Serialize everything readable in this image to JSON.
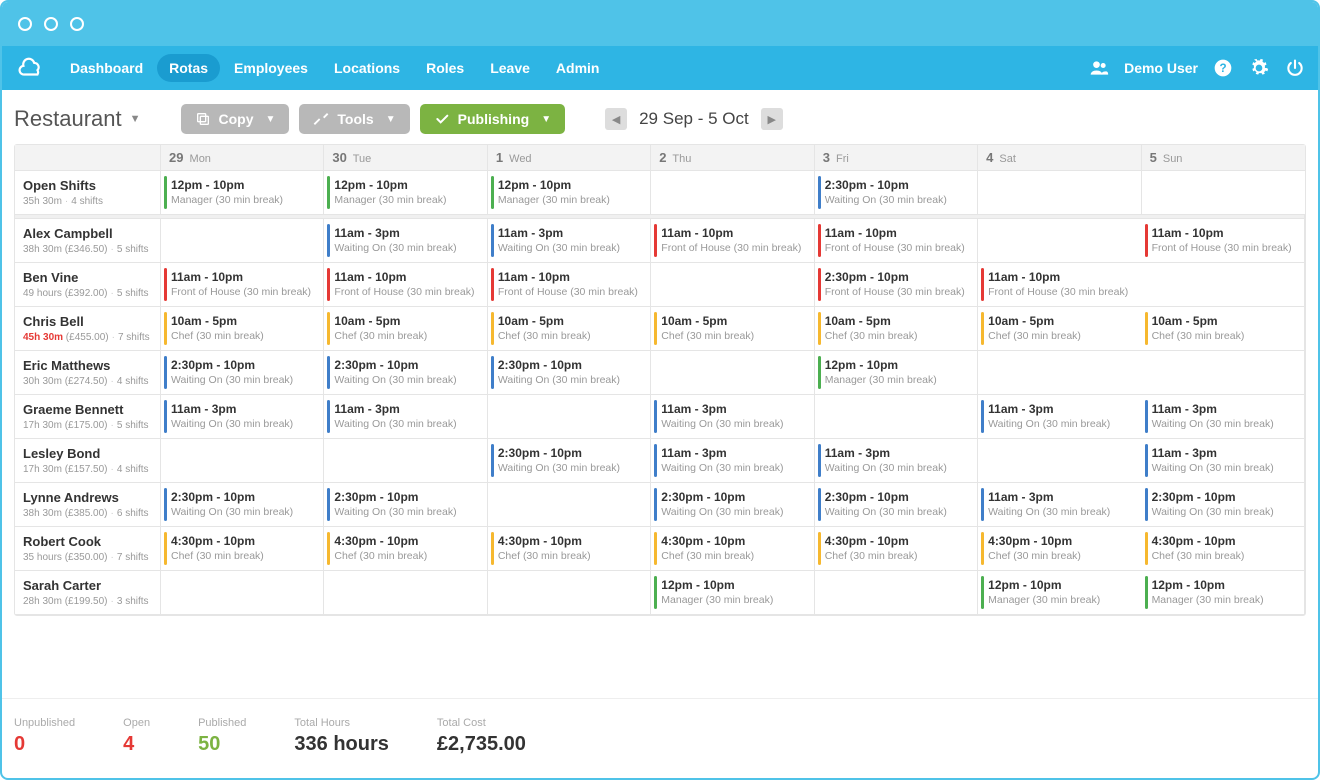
{
  "nav": {
    "items": [
      "Dashboard",
      "Rotas",
      "Employees",
      "Locations",
      "Roles",
      "Leave",
      "Admin"
    ],
    "active": 1,
    "user": "Demo User"
  },
  "page": {
    "title": "Restaurant"
  },
  "buttons": {
    "copy": "Copy",
    "tools": "Tools",
    "publishing": "Publishing"
  },
  "dateRange": "29 Sep - 5 Oct",
  "days": [
    {
      "num": "29",
      "name": "Mon"
    },
    {
      "num": "30",
      "name": "Tue"
    },
    {
      "num": "1",
      "name": "Wed"
    },
    {
      "num": "2",
      "name": "Thu"
    },
    {
      "num": "3",
      "name": "Fri"
    },
    {
      "num": "4",
      "name": "Sat"
    },
    {
      "num": "5",
      "name": "Sun"
    }
  ],
  "roleColors": {
    "Manager": "green",
    "Waiting On": "blue",
    "Front of House": "red",
    "Chef": "yellow"
  },
  "rows": [
    {
      "name": "Open Shifts",
      "meta": "35h 30m",
      "shifts_label": "4 shifts",
      "cells": [
        {
          "time": "12pm - 10pm",
          "role": "Manager (30 min break)"
        },
        {
          "time": "12pm - 10pm",
          "role": "Manager (30 min break)"
        },
        {
          "time": "12pm - 10pm",
          "role": "Manager (30 min break)"
        },
        null,
        {
          "time": "2:30pm - 10pm",
          "role": "Waiting On (30 min break)"
        },
        null,
        null
      ]
    },
    {
      "name": "Alex Campbell",
      "meta": "38h 30m (£346.50)",
      "shifts_label": "5 shifts",
      "cells": [
        null,
        {
          "time": "11am - 3pm",
          "role": "Waiting On (30 min break)"
        },
        {
          "time": "11am - 3pm",
          "role": "Waiting On (30 min break)"
        },
        {
          "time": "11am - 10pm",
          "role": "Front of House (30 min break)"
        },
        {
          "time": "11am - 10pm",
          "role": "Front of House (30 min break)"
        },
        null,
        {
          "time": "11am - 10pm",
          "role": "Front of House (30 min break)"
        }
      ]
    },
    {
      "name": "Ben Vine",
      "meta": "49 hours (£392.00)",
      "shifts_label": "5 shifts",
      "cells": [
        {
          "time": "11am - 10pm",
          "role": "Front of House (30 min break)"
        },
        {
          "time": "11am - 10pm",
          "role": "Front of House (30 min break)"
        },
        {
          "time": "11am - 10pm",
          "role": "Front of House (30 min break)"
        },
        null,
        {
          "time": "2:30pm - 10pm",
          "role": "Front of House (30 min break)"
        },
        {
          "time": "11am - 10pm",
          "role": "Front of House (30 min break)"
        },
        null
      ]
    },
    {
      "name": "Chris Bell",
      "meta": "(£455.00)",
      "hours": "45h 30m",
      "over": true,
      "shifts_label": "7 shifts",
      "cells": [
        {
          "time": "10am - 5pm",
          "role": "Chef (30 min break)"
        },
        {
          "time": "10am - 5pm",
          "role": "Chef (30 min break)"
        },
        {
          "time": "10am - 5pm",
          "role": "Chef (30 min break)"
        },
        {
          "time": "10am - 5pm",
          "role": "Chef (30 min break)"
        },
        {
          "time": "10am - 5pm",
          "role": "Chef (30 min break)"
        },
        {
          "time": "10am - 5pm",
          "role": "Chef (30 min break)"
        },
        {
          "time": "10am - 5pm",
          "role": "Chef (30 min break)"
        }
      ]
    },
    {
      "name": "Eric Matthews",
      "meta": "30h 30m (£274.50)",
      "shifts_label": "4 shifts",
      "cells": [
        {
          "time": "2:30pm - 10pm",
          "role": "Waiting On (30 min break)"
        },
        {
          "time": "2:30pm - 10pm",
          "role": "Waiting On (30 min break)"
        },
        {
          "time": "2:30pm - 10pm",
          "role": "Waiting On (30 min break)"
        },
        null,
        {
          "time": "12pm - 10pm",
          "role": "Manager (30 min break)"
        },
        null,
        null
      ]
    },
    {
      "name": "Graeme Bennett",
      "meta": "17h 30m (£175.00)",
      "shifts_label": "5 shifts",
      "cells": [
        {
          "time": "11am - 3pm",
          "role": "Waiting On (30 min break)"
        },
        {
          "time": "11am - 3pm",
          "role": "Waiting On (30 min break)"
        },
        null,
        {
          "time": "11am - 3pm",
          "role": "Waiting On (30 min break)"
        },
        null,
        {
          "time": "11am - 3pm",
          "role": "Waiting On (30 min break)"
        },
        {
          "time": "11am - 3pm",
          "role": "Waiting On (30 min break)"
        }
      ]
    },
    {
      "name": "Lesley Bond",
      "meta": "17h 30m (£157.50)",
      "shifts_label": "4 shifts",
      "cells": [
        null,
        null,
        {
          "time": "2:30pm - 10pm",
          "role": "Waiting On (30 min break)"
        },
        {
          "time": "11am - 3pm",
          "role": "Waiting On (30 min break)"
        },
        {
          "time": "11am - 3pm",
          "role": "Waiting On (30 min break)"
        },
        null,
        {
          "time": "11am - 3pm",
          "role": "Waiting On (30 min break)"
        }
      ]
    },
    {
      "name": "Lynne Andrews",
      "meta": "38h 30m (£385.00)",
      "shifts_label": "6 shifts",
      "cells": [
        {
          "time": "2:30pm - 10pm",
          "role": "Waiting On (30 min break)"
        },
        {
          "time": "2:30pm - 10pm",
          "role": "Waiting On (30 min break)"
        },
        null,
        {
          "time": "2:30pm - 10pm",
          "role": "Waiting On (30 min break)"
        },
        {
          "time": "2:30pm - 10pm",
          "role": "Waiting On (30 min break)"
        },
        {
          "time": "11am - 3pm",
          "role": "Waiting On (30 min break)"
        },
        {
          "time": "2:30pm - 10pm",
          "role": "Waiting On (30 min break)"
        }
      ]
    },
    {
      "name": "Robert Cook",
      "meta": "35 hours (£350.00)",
      "shifts_label": "7 shifts",
      "cells": [
        {
          "time": "4:30pm - 10pm",
          "role": "Chef (30 min break)"
        },
        {
          "time": "4:30pm - 10pm",
          "role": "Chef (30 min break)"
        },
        {
          "time": "4:30pm - 10pm",
          "role": "Chef (30 min break)"
        },
        {
          "time": "4:30pm - 10pm",
          "role": "Chef (30 min break)"
        },
        {
          "time": "4:30pm - 10pm",
          "role": "Chef (30 min break)"
        },
        {
          "time": "4:30pm - 10pm",
          "role": "Chef (30 min break)"
        },
        {
          "time": "4:30pm - 10pm",
          "role": "Chef (30 min break)"
        }
      ]
    },
    {
      "name": "Sarah Carter",
      "meta": "28h 30m (£199.50)",
      "shifts_label": "3 shifts",
      "cells": [
        null,
        null,
        null,
        {
          "time": "12pm - 10pm",
          "role": "Manager (30 min break)"
        },
        null,
        {
          "time": "12pm - 10pm",
          "role": "Manager (30 min break)"
        },
        {
          "time": "12pm - 10pm",
          "role": "Manager (30 min break)"
        }
      ]
    }
  ],
  "footer": {
    "unpublished": {
      "label": "Unpublished",
      "value": "0"
    },
    "open": {
      "label": "Open",
      "value": "4"
    },
    "published": {
      "label": "Published",
      "value": "50"
    },
    "hours": {
      "label": "Total Hours",
      "value": "336 hours"
    },
    "cost": {
      "label": "Total Cost",
      "value": "£2,735.00"
    }
  }
}
